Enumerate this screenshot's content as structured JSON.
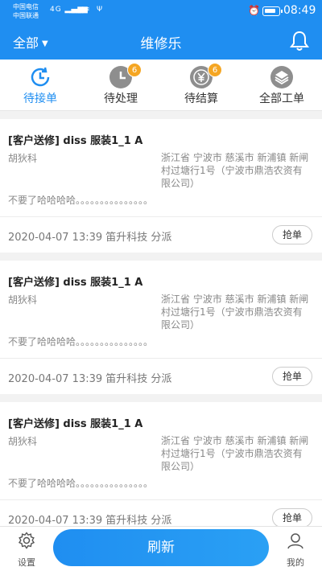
{
  "status_bar": {
    "carrier_1": "中国电信",
    "carrier_2": "中国联通",
    "signal_1": "4G ▂▄▆",
    "signal_2": "▂▄▆",
    "wifi": "≋",
    "usb": "Ψ",
    "time": "08:49",
    "battery_level": 0.85
  },
  "nav": {
    "filter_label": "全部",
    "title": "维修乐"
  },
  "tabs": [
    {
      "label": "待接单",
      "icon": "clock-icon",
      "active": true,
      "badge": ""
    },
    {
      "label": "待处理",
      "icon": "clock-icon",
      "active": false,
      "badge": "6"
    },
    {
      "label": "待结算",
      "icon": "yen-icon",
      "active": false,
      "badge": "6"
    },
    {
      "label": "全部工单",
      "icon": "layers-icon",
      "active": false,
      "badge": ""
    }
  ],
  "orders": [
    {
      "title": "[客户送修] diss 服装1_1 A",
      "customer": "胡狄科",
      "address": "浙江省 宁波市 慈溪市 新浦镇 新闸村过塘行1号（宁波市鼎浩农资有限公司）",
      "description": "不要了哈哈哈哈。。。。。。。。。。。。。。。",
      "meta": "2020-04-07 13:39 笛升科技 分派",
      "action": "抢单"
    },
    {
      "title": "[客户送修] diss 服装1_1 A",
      "customer": "胡狄科",
      "address": "浙江省 宁波市 慈溪市 新浦镇 新闸村过塘行1号（宁波市鼎浩农资有限公司）",
      "description": "不要了哈哈哈哈。。。。。。。。。。。。。。。",
      "meta": "2020-04-07 13:39 笛升科技 分派",
      "action": "抢单"
    },
    {
      "title": "[客户送修] diss 服装1_1 A",
      "customer": "胡狄科",
      "address": "浙江省 宁波市 慈溪市 新浦镇 新闸村过塘行1号（宁波市鼎浩农资有限公司）",
      "description": "不要了哈哈哈哈。。。。。。。。。。。。。。。",
      "meta": "2020-04-07 13:39 笛升科技 分派",
      "action": "抢单"
    }
  ],
  "bottom": {
    "settings_label": "设置",
    "refresh_label": "刷新",
    "mine_label": "我的"
  },
  "colors": {
    "primary": "#1f8ef1",
    "badge": "#f5a623",
    "inactive_icon": "#8e8e8e"
  }
}
